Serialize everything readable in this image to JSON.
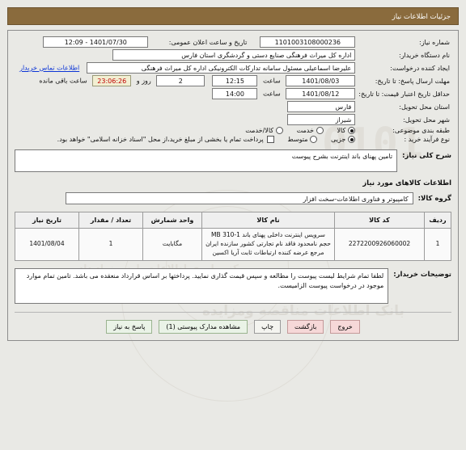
{
  "header": {
    "title": "جزئیات اطلاعات نیاز"
  },
  "form": {
    "need_number_label": "شماره نیاز:",
    "need_number_value": "1101003108000236",
    "announce_label": "تاریخ و ساعت اعلان عمومی:",
    "announce_value": "1401/07/30 - 12:09",
    "buyer_org_label": "نام دستگاه خریدار:",
    "buyer_org_value": "اداره کل میراث فرهنگی  صنایع دستی و گردشگری استان فارس",
    "creator_label": "ایجاد کننده درخواست:",
    "creator_value": "علیرضا اسماعیلی مسئول سامانه تدارکات الکترونیکی اداره کل میراث فرهنگی",
    "contact_link": "اطلاعات تماس خریدار",
    "deadline_label": "مهلت ارسال پاسخ: تا تاریخ:",
    "deadline_date": "1401/08/03",
    "hour_label": "ساعت",
    "deadline_time": "12:15",
    "days_value": "2",
    "days_text": "روز و",
    "countdown_value": "23:06:26",
    "remaining_text": "ساعت باقی مانده",
    "credit_label": "حداقل تاریخ اعتبار قیمت: تا تاریخ:",
    "credit_date": "1401/08/12",
    "credit_time": "14:00",
    "province_label": "استان محل تحویل:",
    "province_value": "فارس",
    "city_label": "شهر محل تحویل:",
    "city_value": "شیراز",
    "category_label": "طبقه بندی موضوعی:",
    "category_options": [
      {
        "label": "کالا",
        "selected": true
      },
      {
        "label": "خدمت",
        "selected": false
      },
      {
        "label": "کالا/خدمت",
        "selected": false
      }
    ],
    "process_label": "نوع فرآیند خرید :",
    "process_options": [
      {
        "label": "جزیی",
        "selected": true
      },
      {
        "label": "متوسط",
        "selected": false
      }
    ],
    "payment_checkbox_label": "پرداخت تمام یا بخشی از مبلغ خرید،از محل \"اسناد خزانه اسلامی\" خواهد بود.",
    "payment_checked": false
  },
  "summary": {
    "label": "شرح کلی نیاز:",
    "value": "تامین پهنای باند اینترنت بشرح پیوست"
  },
  "goods_section": {
    "title": "اطلاعات کالاهای مورد نیاز",
    "group_label": "گروه کالا:",
    "group_value": "کامپیوتر و فناوری اطلاعات-سخت افزار",
    "columns": [
      "ردیف",
      "کد کالا",
      "نام کالا",
      "واحد شمارش",
      "تعداد / مقدار",
      "تاریخ نیاز"
    ],
    "rows": [
      {
        "index": "1",
        "code": "2272200926060002",
        "name": "سرویس اینترنت داخلی پهنای باند 1-310 MB حجم نامحدود فاقد نام تجارتی کشور سازنده ایران مرجع عرضه کننده ارتباطات ثابت آریا اکسین",
        "unit": "مگابایت",
        "quantity": "1",
        "need_date": "1401/08/04"
      }
    ]
  },
  "buyer_notes": {
    "label": "توضیحات خریدار:",
    "value": "لطفا تمام شرایط لیست پیوست را مطالعه و سپس قیمت گذاری نمایید. پرداختها بر اساس قرارداد منعقده می باشد. تامین تمام موارد موجود در درخواست پیوست الزامیست."
  },
  "buttons": [
    {
      "label": "پاسخ به نیاز",
      "style": "green"
    },
    {
      "label": "مشاهده مدارک پیوستی (1)",
      "style": "green"
    },
    {
      "label": "چاپ",
      "style": "plain"
    },
    {
      "label": "بازگشت",
      "style": "pink"
    },
    {
      "label": "خروج",
      "style": "pink"
    }
  ],
  "watermark": {
    "main": "ParsNamadData",
    "big": "0101",
    "big2": "بانک اطلاعات مناقصه ومزایده",
    "fa": "مرکز و اوری اطلاعات پارس نماد داده"
  },
  "colors": {
    "header_bg": "#8a6b3d",
    "link": "#0b34d6",
    "countdown_text": "#c00000",
    "green_btn": "#eaf3e7",
    "pink_btn": "#f6d8d8"
  }
}
